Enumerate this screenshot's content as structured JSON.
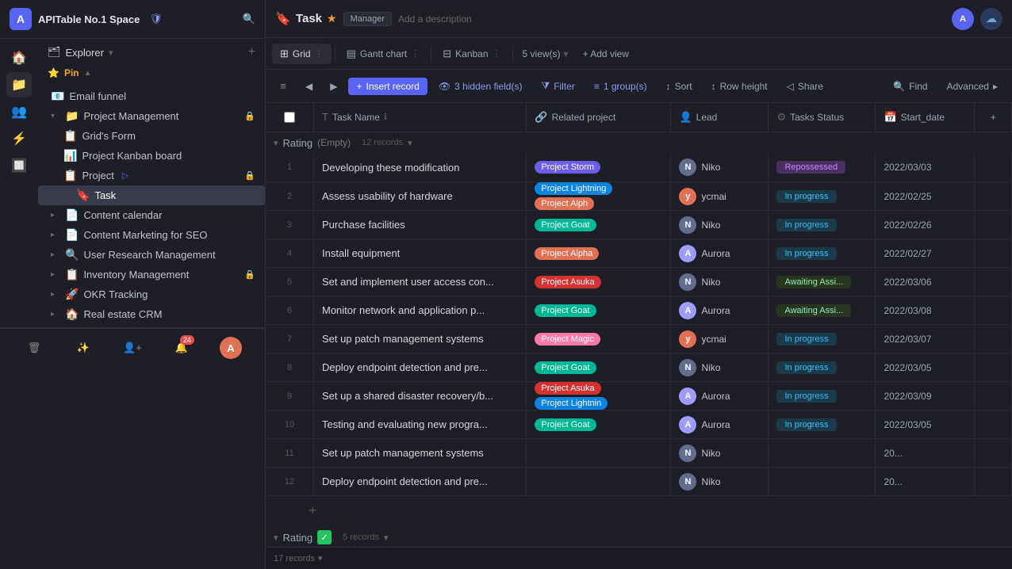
{
  "workspace": {
    "name": "APITable No.1 Space",
    "avatar_letter": "A"
  },
  "sidebar": {
    "explorer_label": "Explorer",
    "sections": [
      {
        "name": "pin",
        "label": "Pin",
        "items": []
      }
    ],
    "tree": [
      {
        "id": "email-funnel",
        "icon": "📧",
        "label": "Email funnel",
        "indent": 0,
        "has_chevron": false
      },
      {
        "id": "project-management",
        "icon": "📁",
        "label": "Project Management",
        "indent": 0,
        "has_chevron": true,
        "expanded": true,
        "has_lock": true
      },
      {
        "id": "grids-form",
        "icon": "📋",
        "label": "Grid's Form",
        "indent": 1
      },
      {
        "id": "project-kanban",
        "icon": "📊",
        "label": "Project Kanban board",
        "indent": 1
      },
      {
        "id": "project",
        "icon": "📋",
        "label": "Project",
        "indent": 1,
        "has_lock": true,
        "has_share": true
      },
      {
        "id": "task",
        "icon": "🔖",
        "label": "Task",
        "indent": 2,
        "active": true
      },
      {
        "id": "content-calendar",
        "icon": "📄",
        "label": "Content calendar",
        "indent": 0,
        "has_chevron": true
      },
      {
        "id": "content-marketing",
        "icon": "📄",
        "label": "Content Marketing for SEO",
        "indent": 0,
        "has_chevron": true
      },
      {
        "id": "user-research",
        "icon": "🔍",
        "label": "User Research Management",
        "indent": 0,
        "has_chevron": true
      },
      {
        "id": "inventory",
        "icon": "📋",
        "label": "Inventory Management",
        "indent": 0,
        "has_chevron": true,
        "has_lock": true
      },
      {
        "id": "okr-tracking",
        "icon": "🚀",
        "label": "OKR Tracking",
        "indent": 0,
        "has_chevron": true
      },
      {
        "id": "real-estate",
        "icon": "🏠",
        "label": "Real estate CRM",
        "indent": 0,
        "has_chevron": true
      }
    ]
  },
  "task": {
    "icon": "🔖",
    "label": "Task",
    "badge": "Manager",
    "description": "Add a description",
    "star": "★"
  },
  "views": {
    "tabs": [
      {
        "id": "grid",
        "icon": "⊞",
        "label": "Grid",
        "active": true
      },
      {
        "id": "gantt",
        "icon": "▤",
        "label": "Gantt chart",
        "active": false
      },
      {
        "id": "kanban",
        "icon": "⊟",
        "label": "Kanban",
        "active": false
      }
    ],
    "view_count_label": "5 view(s)",
    "add_view_label": "+ Add view"
  },
  "toolbar": {
    "insert_label": "Insert record",
    "hidden_fields_label": "3 hidden field(s)",
    "filter_label": "Filter",
    "group_label": "1 group(s)",
    "sort_label": "Sort",
    "row_height_label": "Row height",
    "share_label": "Share",
    "find_label": "Find",
    "advanced_label": "Advanced"
  },
  "columns": [
    {
      "id": "task-name",
      "icon": "T",
      "label": "Task Name",
      "info": true
    },
    {
      "id": "related-project",
      "icon": "🔗",
      "label": "Related project"
    },
    {
      "id": "lead",
      "icon": "👤",
      "label": "Lead"
    },
    {
      "id": "tasks-status",
      "icon": "⚙",
      "label": "Tasks Status"
    },
    {
      "id": "start-date",
      "icon": "📅",
      "label": "Start_date"
    }
  ],
  "group1": {
    "label": "Rating",
    "sub_label": "(Empty)",
    "count": "12 records"
  },
  "rows": [
    {
      "num": 1,
      "task": "Developing these modification",
      "projects": [
        {
          "label": "Project Storm",
          "class": "tag-storm"
        }
      ],
      "lead_avatar": "N",
      "lead_name": "Niko",
      "lead_color": "#636e8c",
      "status": "Repossessed",
      "status_class": "status-repossessed",
      "date": "2022/03/03"
    },
    {
      "num": 2,
      "task": "Assess usability of hardware",
      "projects": [
        {
          "label": "Project Lightning",
          "class": "tag-lightning"
        },
        {
          "label": "Project Alph",
          "class": "tag-alpha"
        }
      ],
      "lead_avatar": "y",
      "lead_name": "ycmai",
      "lead_color": "#e17055",
      "status": "In progress",
      "status_class": "status-in-progress",
      "date": "2022/02/25"
    },
    {
      "num": 3,
      "task": "Purchase facilities",
      "projects": [
        {
          "label": "Project Goat",
          "class": "tag-goat"
        }
      ],
      "lead_avatar": "N",
      "lead_name": "Niko",
      "lead_color": "#636e8c",
      "status": "In progress",
      "status_class": "status-in-progress",
      "date": "2022/02/26"
    },
    {
      "num": 4,
      "task": "Install equipment",
      "projects": [
        {
          "label": "Project Alpha",
          "class": "tag-alpha"
        }
      ],
      "lead_avatar": "A",
      "lead_name": "Aurora",
      "lead_color": "#a29bfe",
      "status": "In progress",
      "status_class": "status-in-progress",
      "date": "2022/02/27"
    },
    {
      "num": 5,
      "task": "Set and implement user access con...",
      "projects": [
        {
          "label": "Project Asuka",
          "class": "tag-asuka"
        }
      ],
      "lead_avatar": "N",
      "lead_name": "Niko",
      "lead_color": "#636e8c",
      "status": "Awaiting Assi...",
      "status_class": "status-awaiting",
      "date": "2022/03/06"
    },
    {
      "num": 6,
      "task": "Monitor network and application p...",
      "projects": [
        {
          "label": "Project Goat",
          "class": "tag-goat"
        }
      ],
      "lead_avatar": "A",
      "lead_name": "Aurora",
      "lead_color": "#a29bfe",
      "status": "Awaiting Assi...",
      "status_class": "status-awaiting",
      "date": "2022/03/08"
    },
    {
      "num": 7,
      "task": "Set up patch management systems",
      "projects": [
        {
          "label": "Project Magic",
          "class": "tag-magic"
        }
      ],
      "lead_avatar": "y",
      "lead_name": "ycmai",
      "lead_color": "#e17055",
      "status": "In progress",
      "status_class": "status-in-progress",
      "date": "2022/03/07"
    },
    {
      "num": 8,
      "task": "Deploy endpoint detection and pre...",
      "projects": [
        {
          "label": "Project Goat",
          "class": "tag-goat"
        }
      ],
      "lead_avatar": "N",
      "lead_name": "Niko",
      "lead_color": "#636e8c",
      "status": "In progress",
      "status_class": "status-in-progress",
      "date": "2022/03/05"
    },
    {
      "num": 9,
      "task": "Set up a shared disaster recovery/b...",
      "projects": [
        {
          "label": "Project Asuka",
          "class": "tag-asuka"
        },
        {
          "label": "Project Lightnin",
          "class": "tag-lightning"
        }
      ],
      "lead_avatar": "A",
      "lead_name": "Aurora",
      "lead_color": "#a29bfe",
      "status": "In progress",
      "status_class": "status-in-progress",
      "date": "2022/03/09"
    },
    {
      "num": 10,
      "task": "Testing and evaluating new progra...",
      "projects": [
        {
          "label": "Project Goat",
          "class": "tag-goat"
        }
      ],
      "lead_avatar": "A",
      "lead_name": "Aurora",
      "lead_color": "#a29bfe",
      "status": "In progress",
      "status_class": "status-in-progress",
      "date": "2022/03/05"
    },
    {
      "num": 11,
      "task": "Set up patch management systems",
      "projects": [],
      "lead_avatar": "N",
      "lead_name": "Niko",
      "lead_color": "#636e8c",
      "status": "",
      "status_class": "",
      "date": "20..."
    },
    {
      "num": 12,
      "task": "Deploy endpoint detection and pre...",
      "projects": [],
      "lead_avatar": "N",
      "lead_name": "Niko",
      "lead_color": "#636e8c",
      "status": "",
      "status_class": "",
      "date": "20..."
    }
  ],
  "group2": {
    "label": "Rating",
    "check": "✓",
    "count": "5 records"
  },
  "bottom_bar": {
    "total_label": "17 records"
  }
}
